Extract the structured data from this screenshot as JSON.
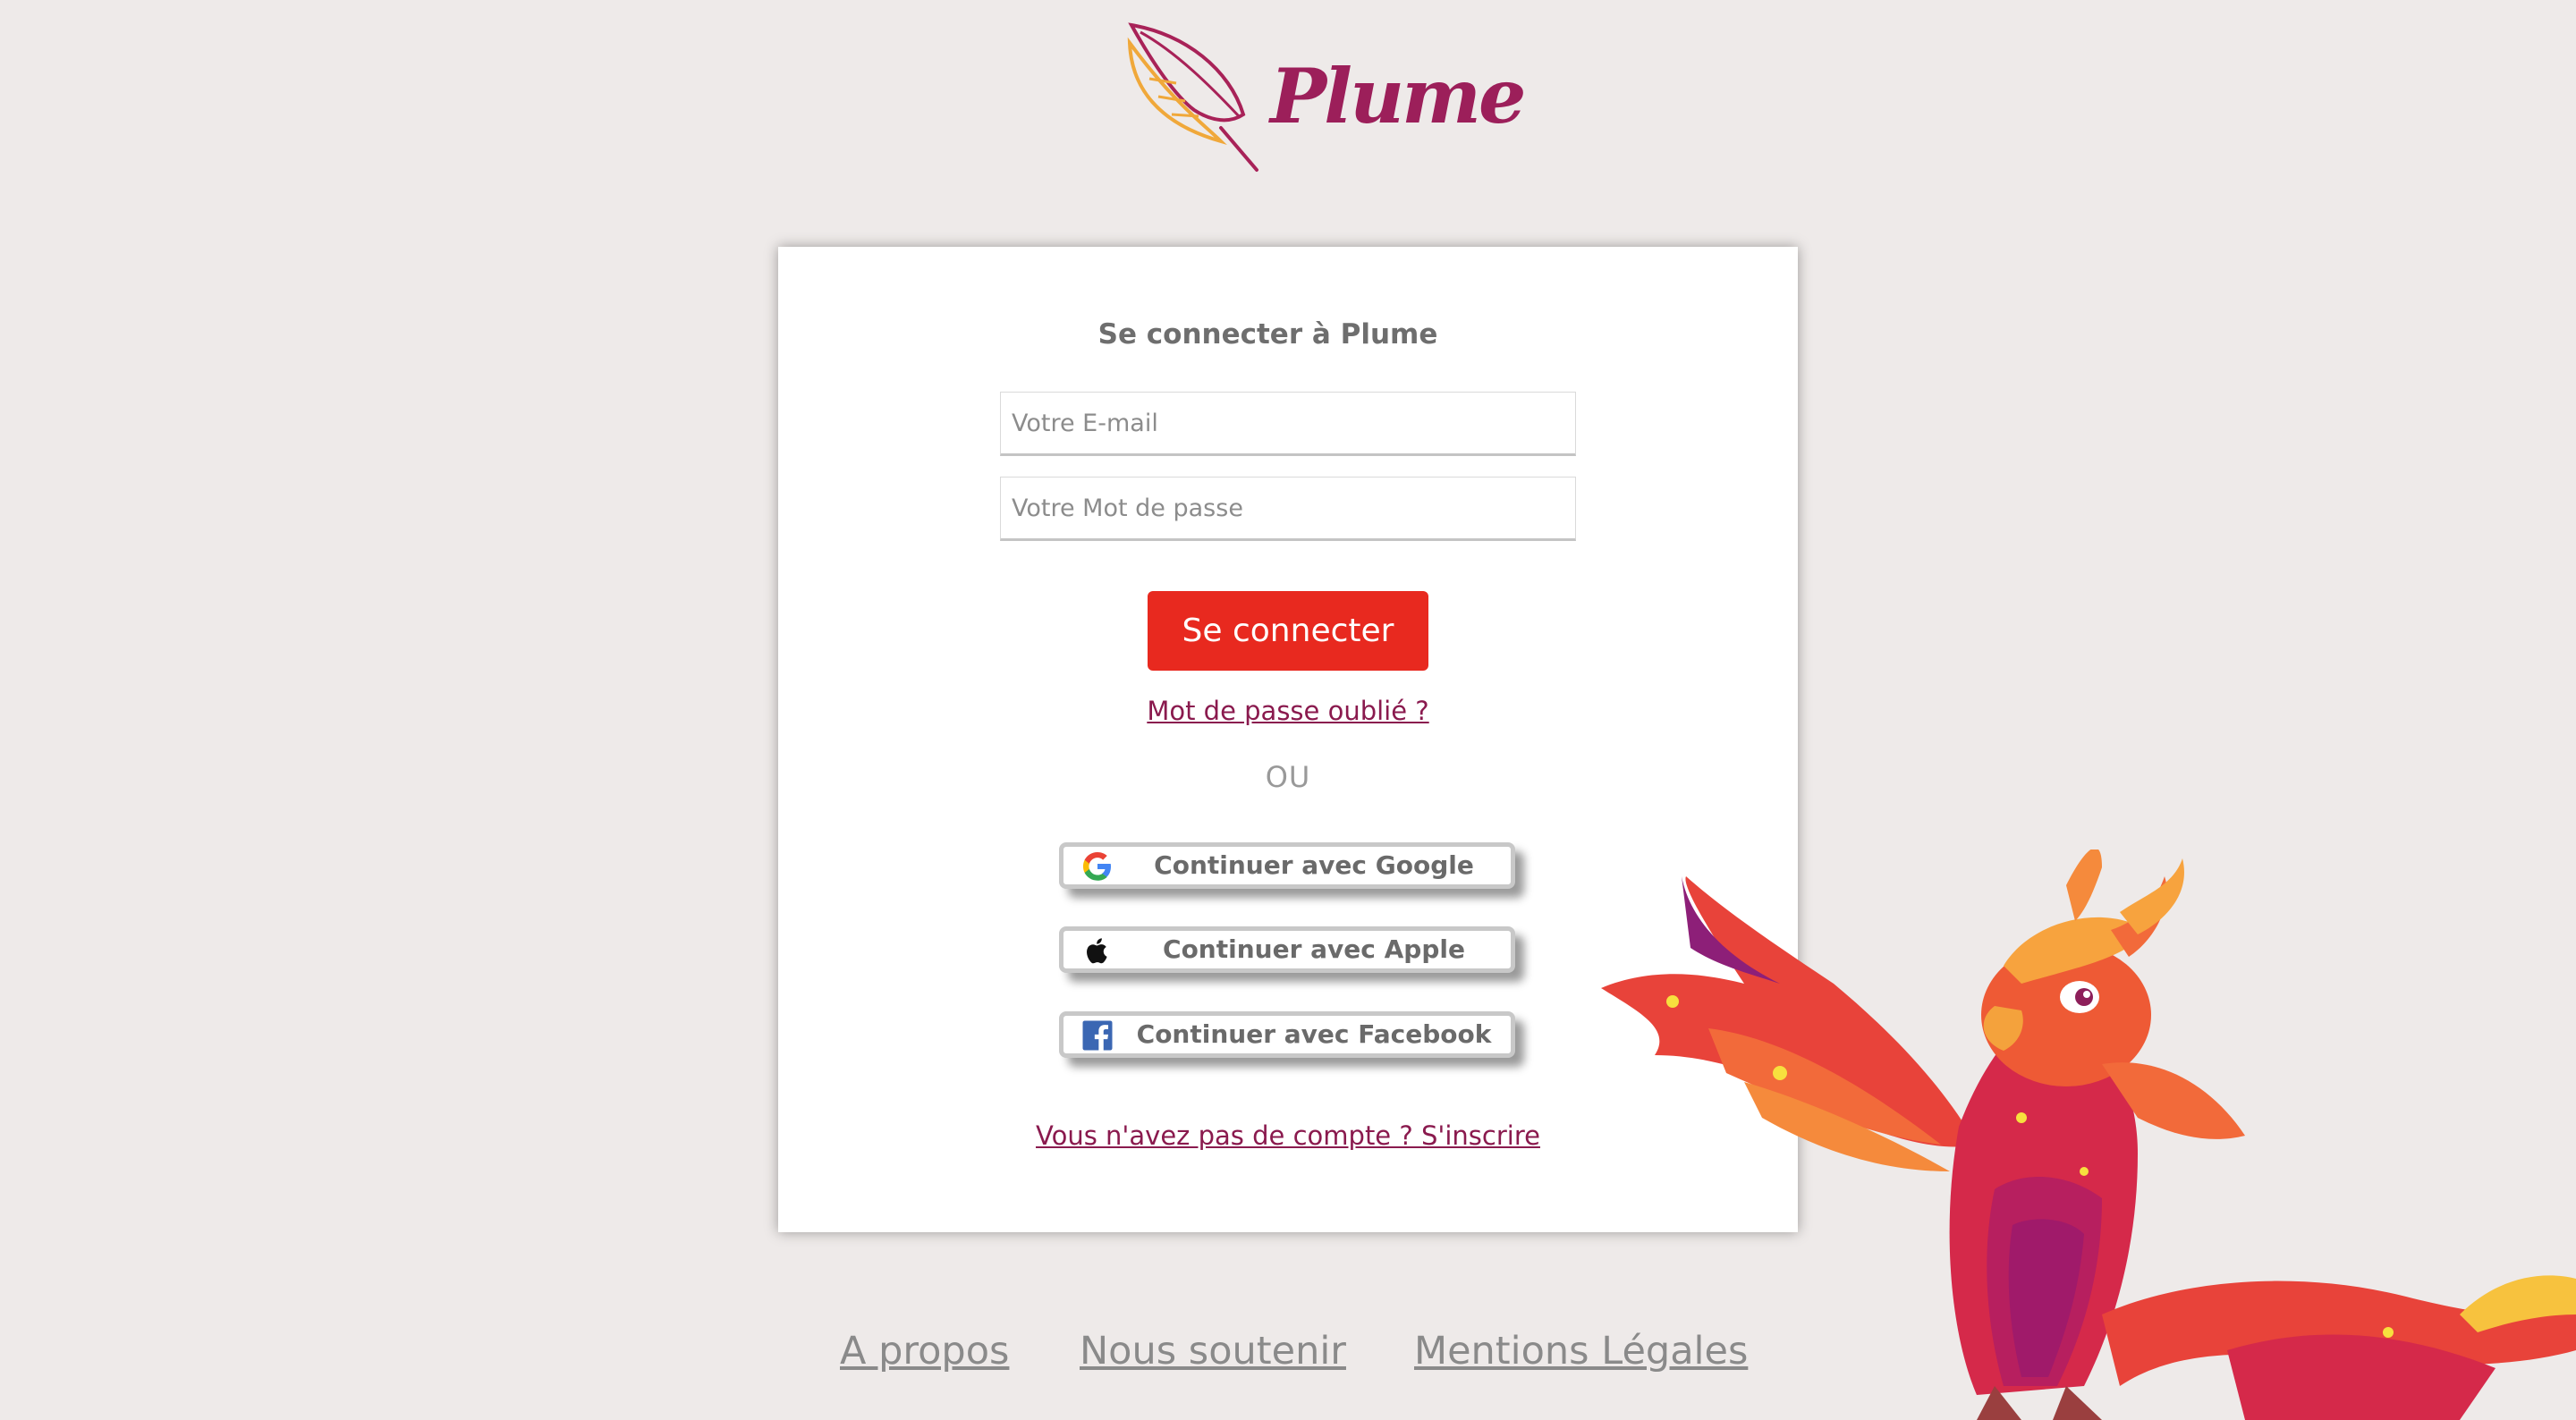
{
  "brand": {
    "name": "Plume",
    "color": "#9c1f5a"
  },
  "login": {
    "title": "Se connecter à Plume",
    "email_placeholder": "Votre E-mail",
    "password_placeholder": "Votre Mot de passe",
    "submit_label": "Se connecter",
    "forgot_password": "Mot de passe oublié ?",
    "separator": "OU",
    "social": [
      {
        "label": "Continuer avec Google",
        "icon": "google-icon"
      },
      {
        "label": "Continuer avec Apple",
        "icon": "apple-icon"
      },
      {
        "label": "Continuer avec Facebook",
        "icon": "facebook-icon"
      }
    ],
    "signup": "Vous n'avez pas de compte ? S'inscrire"
  },
  "footer": {
    "links": [
      "A propos",
      "Nous soutenir",
      "Mentions Légales"
    ]
  },
  "colors": {
    "background": "#eeeae9",
    "primary": "#e8291f",
    "link": "#8a1a4e"
  },
  "illustration": "phoenix-mascot"
}
